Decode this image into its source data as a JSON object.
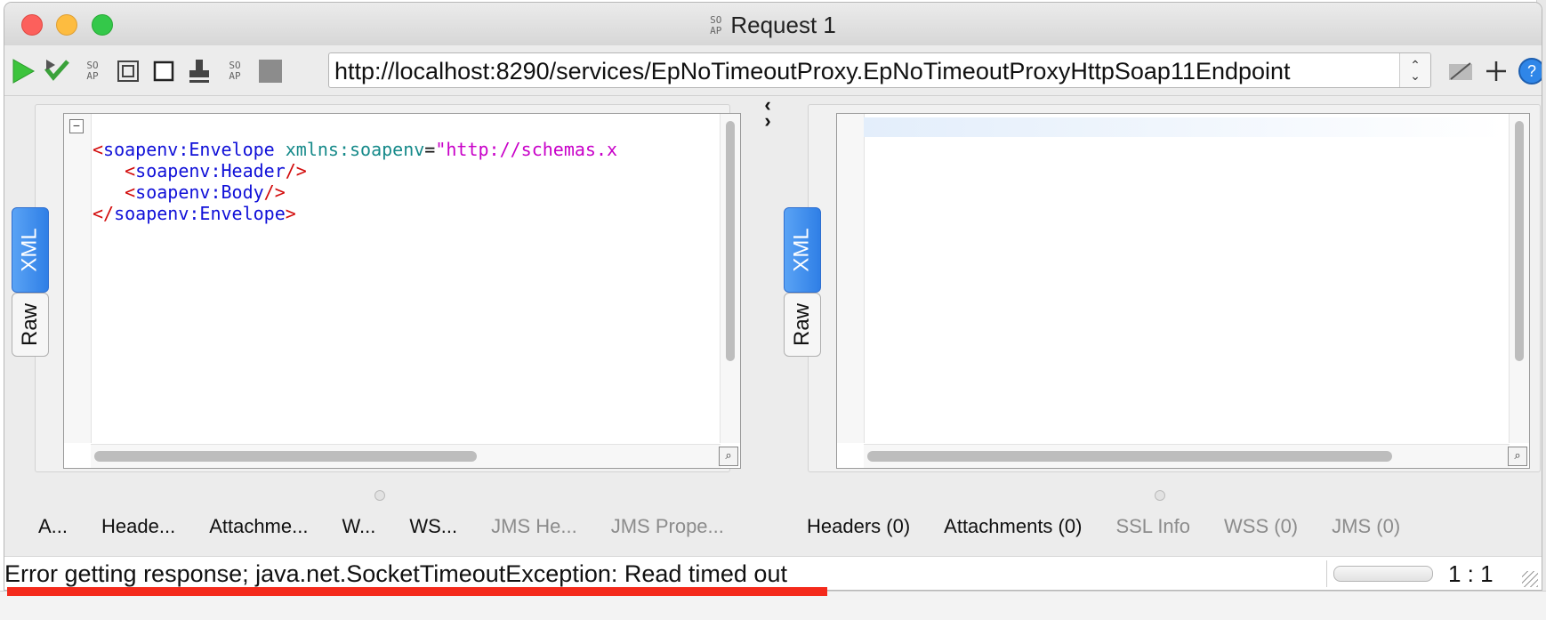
{
  "window": {
    "title": "Request 1",
    "icon": "soapui-icon"
  },
  "toolbar": {
    "endpoint": "http://localhost:8290/services/EpNoTimeoutProxy.EpNoTimeoutProxyHttpSoap11Endpoint",
    "icons": [
      "play-icon",
      "run-all-icon",
      "soap-icon",
      "clone-icon",
      "stop-square-icon",
      "stamp-icon",
      "soap-icon",
      "stop-icon",
      "move-icon",
      "add-icon",
      "help-icon"
    ]
  },
  "request_editor": {
    "lines": [
      {
        "open": "<",
        "tag": "soapenv:Envelope",
        "attr": " xmlns:soapenv",
        "eq": "=",
        "value": "\"http://schemas.x"
      },
      {
        "indent": "   ",
        "open": "<",
        "tag": "soapenv:Header",
        "close": "/>"
      },
      {
        "indent": "   ",
        "open": "<",
        "tag": "soapenv:Body",
        "close": "/>"
      },
      {
        "open": "</",
        "tag": "soapenv:Envelope",
        "close": ">"
      }
    ],
    "fold_symbol": "−",
    "tabs": {
      "xml": "XML",
      "raw": "Raw"
    }
  },
  "response_editor": {
    "tabs": {
      "xml": "XML",
      "raw": "Raw"
    }
  },
  "request_bottom_tabs": [
    {
      "label": "A...",
      "enabled": true
    },
    {
      "label": "Heade...",
      "enabled": true
    },
    {
      "label": "Attachme...",
      "enabled": true
    },
    {
      "label": "W...",
      "enabled": true
    },
    {
      "label": "WS...",
      "enabled": true
    },
    {
      "label": "JMS He...",
      "enabled": false
    },
    {
      "label": "JMS Prope...",
      "enabled": false
    }
  ],
  "response_bottom_tabs": [
    {
      "label": "Headers (0)",
      "enabled": true
    },
    {
      "label": "Attachments (0)",
      "enabled": true
    },
    {
      "label": "SSL Info",
      "enabled": false
    },
    {
      "label": "WSS (0)",
      "enabled": false
    },
    {
      "label": "JMS (0)",
      "enabled": false
    }
  ],
  "status_bar": {
    "message": "Error getting response; java.net.SocketTimeoutException: Read timed out",
    "cursor_position": "1 : 1"
  },
  "colors": {
    "accent_tab": "#2f7fe6",
    "error_underline": "#f42a1c"
  }
}
